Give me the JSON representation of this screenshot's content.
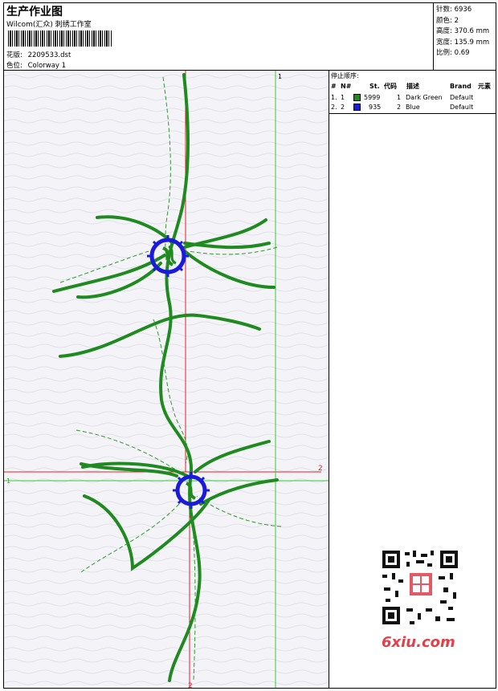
{
  "header": {
    "title": "生产作业图",
    "subtitle": "Wilcom(汇众) 刺绣工作室",
    "design_label": "花版:",
    "design_file": "2209533.dst",
    "colorway_label": "色位:",
    "colorway": "Colorway 1"
  },
  "stats": [
    {
      "label": "针数:",
      "value": "6936"
    },
    {
      "label": "颜色:",
      "value": "2"
    },
    {
      "label": "高度:",
      "value": "370.6 mm"
    },
    {
      "label": "宽度:",
      "value": "135.9 mm"
    },
    {
      "label": "比例:",
      "value": "0.69"
    }
  ],
  "stop_sequence": {
    "heading": "停止顺序:",
    "columns": [
      "#",
      "N#",
      "St.",
      "代码",
      "描述",
      "Brand",
      "元素"
    ],
    "rows": [
      {
        "idx": "1.",
        "n": "1",
        "color": "#1f8a1f",
        "stitches": "5999",
        "code": "1",
        "desc": "Dark Green",
        "brand": "Default"
      },
      {
        "idx": "2.",
        "n": "2",
        "color": "#1a1adb",
        "stitches": "935",
        "code": "2",
        "desc": "Blue",
        "brand": "Default"
      }
    ]
  },
  "markers": {
    "top_one": "1",
    "right_two": "2",
    "left_one": "1",
    "bottom_two": "2"
  },
  "watermark": "6xiu.com",
  "colors": {
    "green_thread": "#1f8a1f",
    "blue_thread": "#1a1adb",
    "guide_red": "#e0202a",
    "guide_green": "#33cc33"
  }
}
